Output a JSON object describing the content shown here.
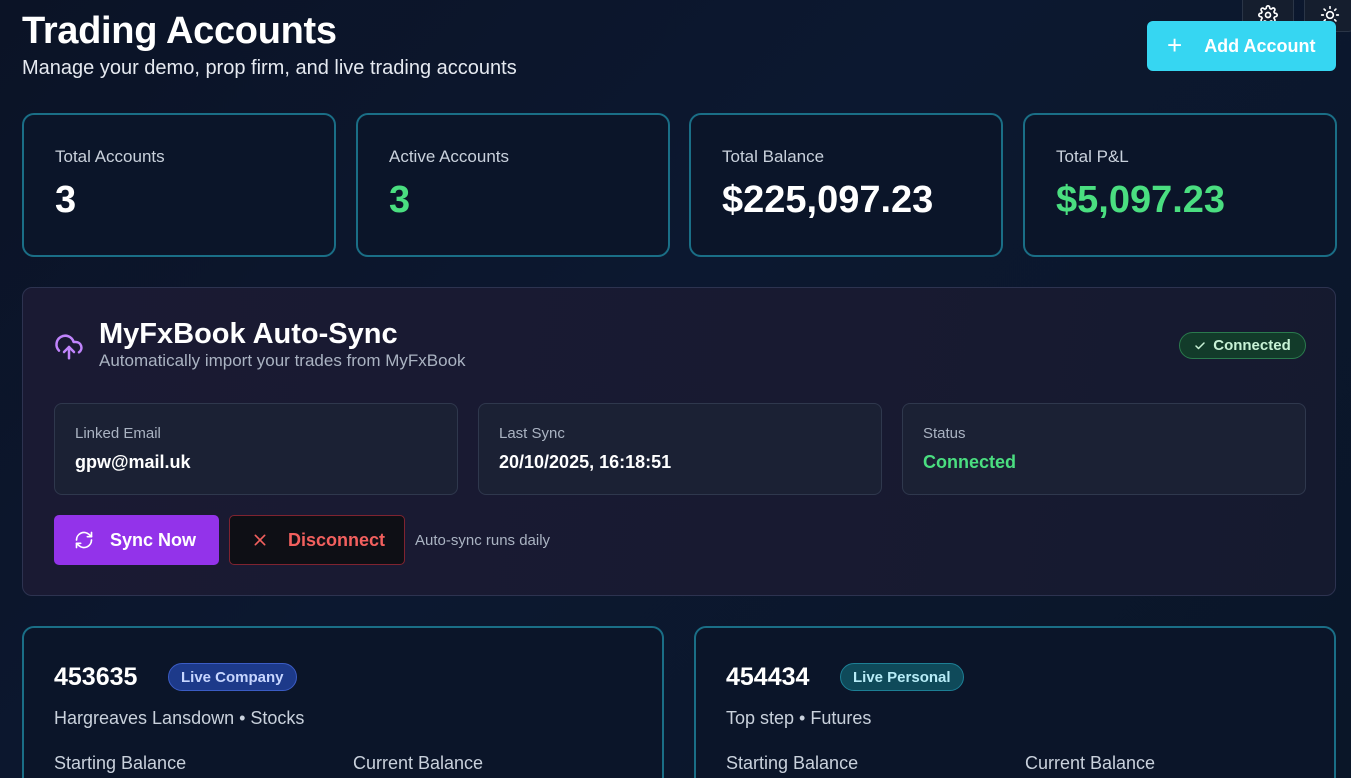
{
  "header": {
    "title": "Trading Accounts",
    "subtitle": "Manage your demo, prop firm, and live trading accounts",
    "add_account_label": "Add Account"
  },
  "colors": {
    "accent_cyan": "#36d6f2",
    "positive_green": "#4ade80",
    "purple": "#9333ea",
    "danger_red": "#f2605e",
    "card_border": "#1a6e86"
  },
  "stats": [
    {
      "label": "Total Accounts",
      "value": "3"
    },
    {
      "label": "Active Accounts",
      "value": "3"
    },
    {
      "label": "Total Balance",
      "value": "$225,097.23"
    },
    {
      "label": "Total P&L",
      "value": "$5,097.23"
    }
  ],
  "myfxbook": {
    "title": "MyFxBook Auto-Sync",
    "subtitle": "Automatically import your trades from MyFxBook",
    "badge": "Connected",
    "info": [
      {
        "label": "Linked Email",
        "value": "gpw@mail.uk"
      },
      {
        "label": "Last Sync",
        "value": "20/10/2025, 16:18:51"
      },
      {
        "label": "Status",
        "value": "Connected"
      }
    ],
    "sync_now_label": "Sync Now",
    "disconnect_label": "Disconnect",
    "note": "Auto-sync runs daily"
  },
  "accounts": [
    {
      "number": "453635",
      "badge": "Live Company",
      "subtitle": "Hargreaves Lansdown • Stocks",
      "starting_label": "Starting Balance",
      "current_label": "Current Balance"
    },
    {
      "number": "454434",
      "badge": "Live Personal",
      "subtitle": "Top step • Futures",
      "starting_label": "Starting Balance",
      "current_label": "Current Balance"
    }
  ]
}
